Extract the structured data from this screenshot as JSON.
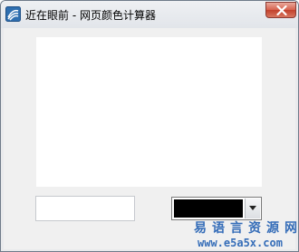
{
  "window": {
    "title": "近在眼前 - 网页颜色计算器",
    "app_icon": "logo-icon",
    "close_icon": "close-icon"
  },
  "colors": {
    "selected_color": "#000000",
    "accent": "#356db8"
  },
  "hex_input": {
    "value": "",
    "placeholder": ""
  },
  "color_select": {
    "dropdown_icon": "chevron-down-icon"
  },
  "watermark": {
    "site_name": "易语言资源网",
    "url": "www.e5a5x.com"
  }
}
